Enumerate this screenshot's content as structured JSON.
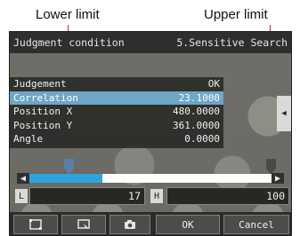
{
  "callouts": {
    "lower": "Lower limit",
    "upper": "Upper limit"
  },
  "colors": {
    "leader_line": "#c8281e",
    "selected_row": "#6fa5c6",
    "slider_fill": "#2ea4dc"
  },
  "titlebar": {
    "left": "Judgment condition",
    "right": "5.Sensitive Search"
  },
  "results": [
    {
      "label": "Judgement",
      "value": "OK",
      "selected": false
    },
    {
      "label": "Correlation",
      "value": "23.1000",
      "selected": true
    },
    {
      "label": "Position X",
      "value": "480.0000",
      "selected": false
    },
    {
      "label": "Position Y",
      "value": "361.0000",
      "selected": false
    },
    {
      "label": "Angle",
      "value": "0.0000",
      "selected": false
    }
  ],
  "side_tab": {
    "icon": "triangle-left-icon"
  },
  "slider": {
    "lower": 17,
    "upper": 100,
    "max": 100,
    "fill_fraction": 0.3
  },
  "fields": {
    "l_label": "L",
    "h_label": "H",
    "lower_value": "17",
    "upper_value": "100"
  },
  "buttons": [
    {
      "name": "frame-icon-button",
      "icon": "frame-icon"
    },
    {
      "name": "zoom-icon-button",
      "icon": "zoom-icon"
    },
    {
      "name": "camera-icon-button",
      "icon": "camera-icon"
    },
    {
      "name": "ok-button",
      "label": "OK"
    },
    {
      "name": "cancel-button",
      "label": "Cancel"
    }
  ]
}
